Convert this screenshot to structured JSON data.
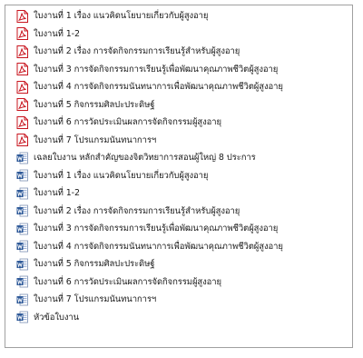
{
  "files": [
    {
      "name": "ใบงานที่ 1 เรื่อง  แนวคิดนโยบายเกี่ยวกับผู้สูงอายุ",
      "type": "pdf",
      "icon": "pdf-file-icon"
    },
    {
      "name": "ใบงานที่ 1-2",
      "type": "pdf",
      "icon": "pdf-file-icon"
    },
    {
      "name": "ใบงานที่ 2 เรื่อง การจัดกิจกรรมการเรียนรู้สำหรับผู้สูงอายุ",
      "type": "pdf",
      "icon": "pdf-file-icon"
    },
    {
      "name": "ใบงานที่ 3 การจัดกิจกรรมการเรียนรู้เพื่อพัฒนาคุณภาพชีวิตผู้สูงอายุ",
      "type": "pdf",
      "icon": "pdf-file-icon"
    },
    {
      "name": "ใบงานที่ 4 การจัดกิจกรรมนันทนาการเพื่อพัฒนาคุณภาพชีวิตผู้สูงอายุ",
      "type": "pdf",
      "icon": "pdf-file-icon"
    },
    {
      "name": "ใบงานที่ 5 กิจกรรมศิลปะประดิษฐ์",
      "type": "pdf",
      "icon": "pdf-file-icon"
    },
    {
      "name": "ใบงานที่ 6  การวัดประเมินผลการจัดกิจกรรมผู้สูงอายุ",
      "type": "pdf",
      "icon": "pdf-file-icon"
    },
    {
      "name": "ใบงานที่ 7 โปรแกรมนันทนาการฯ",
      "type": "pdf",
      "icon": "pdf-file-icon"
    },
    {
      "name": "เฉลยใบงาน  หลักสำคัญของจิตวิทยาการสอนผู้ใหญ่ 8 ประการ",
      "type": "word",
      "icon": "word-file-icon"
    },
    {
      "name": "ใบงานที่ 1 เรื่อง  แนวคิดนโยบายเกี่ยวกับผู้สูงอายุ",
      "type": "word",
      "icon": "word-file-icon"
    },
    {
      "name": "ใบงานที่ 1-2",
      "type": "word",
      "icon": "word-file-icon"
    },
    {
      "name": "ใบงานที่ 2 เรื่อง การจัดกิจกรรมการเรียนรู้สำหรับผู้สูงอายุ",
      "type": "word",
      "icon": "word-file-icon"
    },
    {
      "name": "ใบงานที่ 3 การจัดกิจกรรมการเรียนรู้เพื่อพัฒนาคุณภาพชีวิตผู้สูงอายุ",
      "type": "word",
      "icon": "word-file-icon"
    },
    {
      "name": "ใบงานที่ 4 การจัดกิจกรรมนันทนาการเพื่อพัฒนาคุณภาพชีวิตผู้สูงอายุ",
      "type": "word",
      "icon": "word-file-icon"
    },
    {
      "name": "ใบงานที่ 5 กิจกรรมศิลปะประดิษฐ์",
      "type": "word",
      "icon": "word-file-icon"
    },
    {
      "name": "ใบงานที่ 6  การวัดประเมินผลการจัดกิจกรรมผู้สูงอายุ",
      "type": "word",
      "icon": "word-file-icon"
    },
    {
      "name": "ใบงานที่ 7 โปรแกรมนันทนาการฯ",
      "type": "word",
      "icon": "word-file-icon"
    },
    {
      "name": "หัวข้อใบงาน",
      "type": "word",
      "icon": "word-file-icon"
    }
  ],
  "colors": {
    "pdf_accent": "#c8141e",
    "word_accent": "#2b5797",
    "panel_border": "#a0a0a0",
    "text": "#1a1a1a"
  }
}
